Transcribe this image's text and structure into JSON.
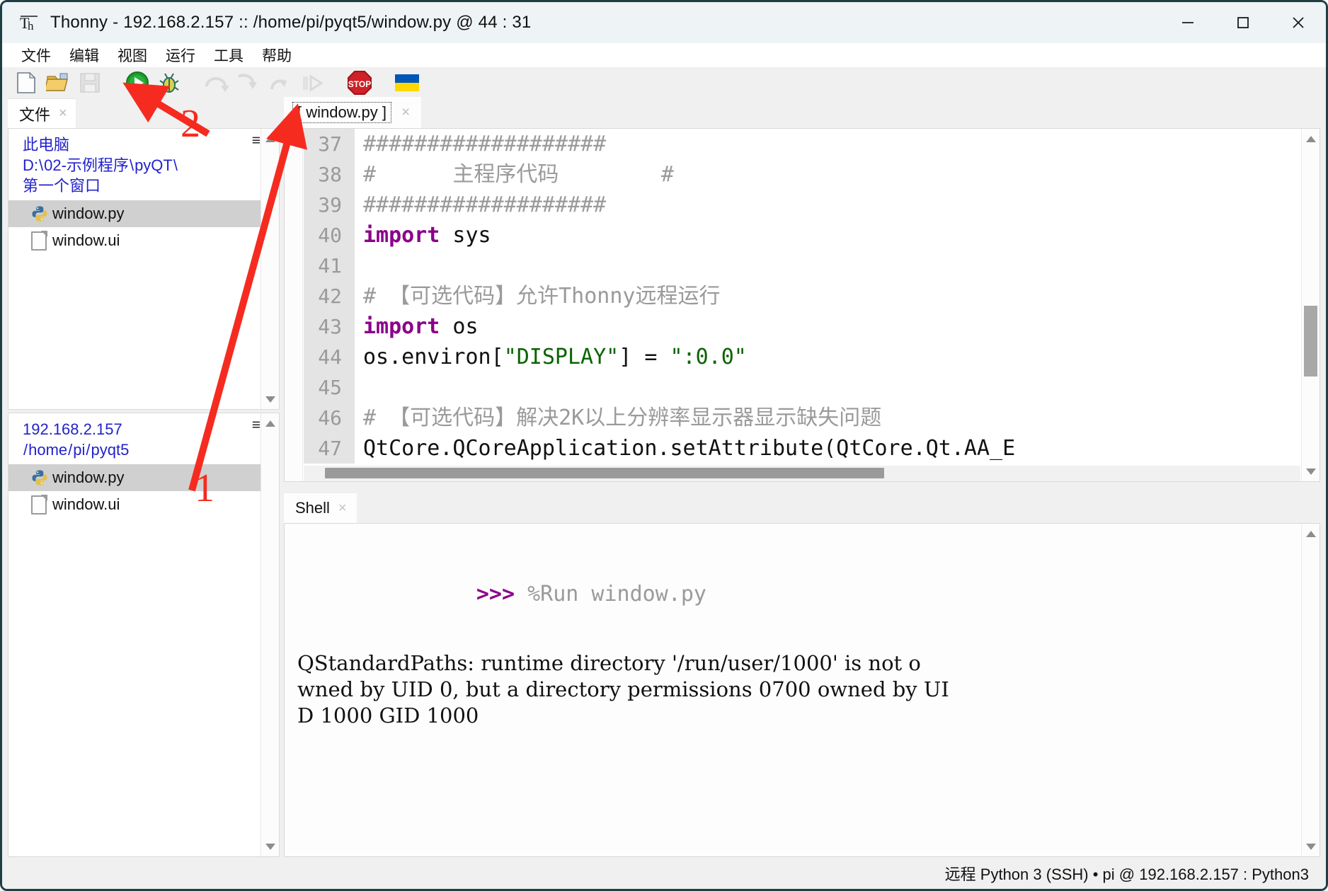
{
  "window": {
    "app_icon": "thonny-icon",
    "title": "Thonny  -  192.168.2.157 :: /home/pi/pyqt5/window.py  @  44 : 31",
    "minimize_label": "—",
    "maximize_label": "□",
    "close_label": "✕"
  },
  "menubar": {
    "items": [
      {
        "label": "文件",
        "name": "menu-file"
      },
      {
        "label": "编辑",
        "name": "menu-edit"
      },
      {
        "label": "视图",
        "name": "menu-view"
      },
      {
        "label": "运行",
        "name": "menu-run"
      },
      {
        "label": "工具",
        "name": "menu-tools"
      },
      {
        "label": "帮助",
        "name": "menu-help"
      }
    ]
  },
  "toolbar": {
    "buttons": [
      {
        "name": "new-file-button",
        "icon": "new-document-icon",
        "enabled": true
      },
      {
        "name": "open-file-button",
        "icon": "open-folder-icon",
        "enabled": true
      },
      {
        "name": "save-file-button",
        "icon": "floppy-save-icon",
        "enabled": false
      },
      {
        "name": "run-button",
        "icon": "green-play-icon",
        "enabled": true
      },
      {
        "name": "debug-button",
        "icon": "bug-debug-icon",
        "enabled": true
      },
      {
        "name": "step-over-button",
        "icon": "step-over-arrow-icon",
        "enabled": false
      },
      {
        "name": "step-into-button",
        "icon": "step-into-arrow-icon",
        "enabled": false
      },
      {
        "name": "step-out-button",
        "icon": "step-out-arrow-icon",
        "enabled": false
      },
      {
        "name": "resume-button",
        "icon": "resume-bar-play-icon",
        "enabled": false
      },
      {
        "name": "stop-button",
        "icon": "stop-sign-icon",
        "enabled": true
      },
      {
        "name": "ukraine-flag-button",
        "icon": "ukraine-flag-icon",
        "enabled": true
      }
    ]
  },
  "files_panel": {
    "tab_label": "文件",
    "tab_close": "×",
    "menu_icon": "≡",
    "local": {
      "header_lines": [
        "此电脑",
        "D:\\02-示例程序\\pyQT\\",
        "第一个窗口"
      ],
      "header_l1": "此电脑",
      "header_l2_parts": [
        "D:",
        "\\",
        "02-示例程序",
        "\\",
        "pyQT",
        "\\"
      ],
      "header_l3": "第一个窗口",
      "items": [
        {
          "label": "window.py",
          "icon": "python-file-icon",
          "selected": true
        },
        {
          "label": "window.ui",
          "icon": "generic-file-icon",
          "selected": false
        }
      ]
    },
    "remote": {
      "header_l1": "192.168.2.157",
      "header_l2_parts": [
        "/",
        "home",
        "/",
        "pi",
        "/",
        "pyqt5"
      ],
      "items": [
        {
          "label": "window.py",
          "icon": "python-file-icon",
          "selected": true
        },
        {
          "label": "window.ui",
          "icon": "generic-file-icon",
          "selected": false
        }
      ]
    }
  },
  "editor": {
    "tab_label": "[ window.py ]",
    "tab_close": "×",
    "lines": [
      {
        "num": "37",
        "segments": [
          {
            "t": "###################",
            "c": "cm"
          }
        ]
      },
      {
        "num": "38",
        "segments": [
          {
            "t": "#      ",
            "c": "cm"
          },
          {
            "t": "主程序代码",
            "c": "cm b"
          },
          {
            "t": "        #",
            "c": "cm"
          }
        ]
      },
      {
        "num": "39",
        "segments": [
          {
            "t": "###################",
            "c": "cm"
          }
        ]
      },
      {
        "num": "40",
        "segments": [
          {
            "t": "import",
            "c": "k"
          },
          {
            "t": " sys",
            "c": ""
          }
        ]
      },
      {
        "num": "41",
        "segments": [
          {
            "t": "",
            "c": ""
          }
        ]
      },
      {
        "num": "42",
        "segments": [
          {
            "t": "# ",
            "c": "cm"
          },
          {
            "t": "【可选代码】允许",
            "c": "cm b"
          },
          {
            "t": "Thonny",
            "c": "cm"
          },
          {
            "t": "远程运行",
            "c": "cm b"
          }
        ]
      },
      {
        "num": "43",
        "segments": [
          {
            "t": "import",
            "c": "k"
          },
          {
            "t": " os",
            "c": ""
          }
        ]
      },
      {
        "num": "44",
        "segments": [
          {
            "t": "os.environ[",
            "c": ""
          },
          {
            "t": "\"DISPLAY\"",
            "c": "s"
          },
          {
            "t": "] = ",
            "c": ""
          },
          {
            "t": "\":0.0\"",
            "c": "s"
          }
        ]
      },
      {
        "num": "45",
        "segments": [
          {
            "t": "",
            "c": ""
          }
        ]
      },
      {
        "num": "46",
        "segments": [
          {
            "t": "# ",
            "c": "cm"
          },
          {
            "t": "【可选代码】解决",
            "c": "cm b"
          },
          {
            "t": "2K",
            "c": "cm"
          },
          {
            "t": "以上分辨率显示器显示缺失问题",
            "c": "cm b"
          }
        ]
      },
      {
        "num": "47",
        "segments": [
          {
            "t": "QtCore.QCoreApplication.setAttribute(QtCore.Qt.AA_E",
            "c": ""
          }
        ]
      }
    ]
  },
  "shell": {
    "tab_label": "Shell",
    "tab_close": "×",
    "prompt": ">>>",
    "command": "%Run window.py",
    "output": "QStandardPaths: runtime directory '/run/user/1000' is not o\nwned by UID 0, but a directory permissions 0700 owned by UI\nD 1000 GID 1000"
  },
  "statusbar": {
    "text": "远程 Python 3 (SSH)  •  pi @ 192.168.2.157 : Python3"
  },
  "annotations": {
    "marker_1": "1",
    "marker_2": "2",
    "color": "#f52b20"
  }
}
